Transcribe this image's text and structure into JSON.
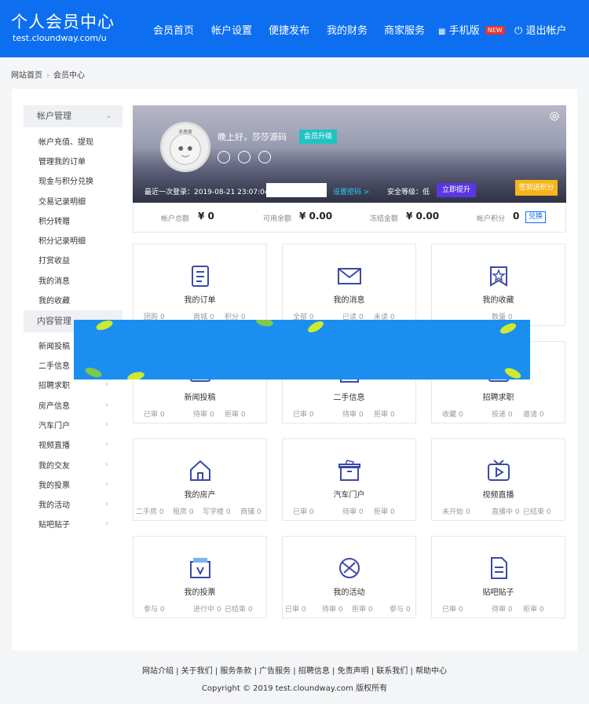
{
  "header": {
    "title": "个人会员中心",
    "url": "test.cloundway.com/u",
    "nav": [
      "会员首页",
      "帐户设置",
      "便捷发布",
      "我的财务",
      "商家服务"
    ],
    "mobile": "手机版",
    "new_badge": "NEW",
    "logout": "退出帐户",
    "color": "#0d6ff0"
  },
  "breadcrumb": {
    "home": "网站首页",
    "current": "会员中心"
  },
  "sidebar": {
    "account_section": "帐户管理",
    "account_items": [
      "帐户充值、提现",
      "管理我的订单",
      "现金与积分兑换",
      "交易记录明细",
      "积分转赠",
      "积分记录明细",
      "打赏收益",
      "我的消息",
      "我的收藏"
    ],
    "content_section": "内容管理",
    "content_items": [
      "新闻投稿",
      "二手信息",
      "招聘求职",
      "房产信息",
      "汽车门户",
      "视频直播",
      "我的交友",
      "我的投票",
      "我的活动",
      "贴吧贴子"
    ]
  },
  "profile": {
    "avatar_text": "多燕瘦",
    "greeting": "晚上好，莎莎源码",
    "upgrade": "会员升级",
    "last_login": "最近一次登录：2019-08-21 23:07:04",
    "set_password": "设置密码 >",
    "security_level": "安全等级：低",
    "security_upgrade": "立即提升",
    "sign_in": "签到送积分"
  },
  "balance": {
    "total_label": "帐户总额",
    "total_value": "¥ 0",
    "avail_label": "可用余额",
    "avail_value": "¥ 0.00",
    "frozen_label": "冻结金额",
    "frozen_value": "¥ 0.00",
    "points_label": "帐户积分",
    "points_value": "0",
    "exchange": "兑换"
  },
  "cards": [
    {
      "title": "我的订单",
      "icon": "order-icon",
      "stats": [
        "团购 0",
        "商城 0",
        "积分 0"
      ]
    },
    {
      "title": "我的消息",
      "icon": "message-icon",
      "stats": [
        "全部 0",
        "已读 0",
        "未读 0"
      ]
    },
    {
      "title": "我的收藏",
      "icon": "favorite-icon",
      "stats": [
        "数量 0"
      ]
    },
    {
      "title": "新闻投稿",
      "icon": "news-icon",
      "stats": [
        "已审 0",
        "待审 0",
        "拒审 0"
      ]
    },
    {
      "title": "二手信息",
      "icon": "secondhand-icon",
      "stats": [
        "已审 0",
        "待审 0",
        "拒审 0"
      ]
    },
    {
      "title": "招聘求职",
      "icon": "job-icon",
      "stats": [
        "收藏 0",
        "投递 0",
        "邀请 0"
      ]
    },
    {
      "title": "我的房产",
      "icon": "house-icon",
      "stats": [
        "二手房 0",
        "租房 0",
        "写字楼 0",
        "商铺 0"
      ]
    },
    {
      "title": "汽车门户",
      "icon": "car-icon",
      "stats": [
        "已审 0",
        "待审 0",
        "拒审 0"
      ]
    },
    {
      "title": "视频直播",
      "icon": "tv-icon",
      "stats": [
        "未开始 0",
        "直播中 0",
        "已结束 0"
      ]
    },
    {
      "title": "我的投票",
      "icon": "vote-icon",
      "stats": [
        "参与 0",
        "进行中 0",
        "已结束 0"
      ]
    },
    {
      "title": "我的活动",
      "icon": "activity-icon",
      "stats": [
        "已审 0",
        "待审 0",
        "拒审 0",
        "参与 0"
      ]
    },
    {
      "title": "贴吧贴子",
      "icon": "post-icon",
      "stats": [
        "已审 0",
        "待审 0",
        "拒审 0"
      ]
    }
  ],
  "footer": {
    "links": "网站介绍 | 关于我们 | 服务条款 | 广告服务 | 招聘信息 | 免责声明 | 联系我们 | 帮助中心",
    "copyright": "Copyright © 2019 test.cloundway.com 版权所有"
  }
}
